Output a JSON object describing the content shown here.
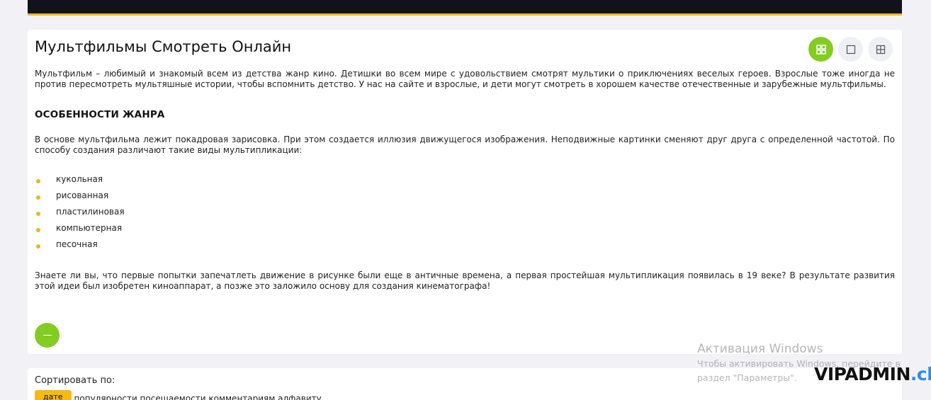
{
  "page": {
    "title": "Мультфильмы Смотреть Онлайн",
    "intro": "Мультфильм – любимый и знакомый всем из детства жанр кино. Детишки во всем мире с удовольствием смотрят мультики о приключениях веселых героев. Взрослые тоже иногда не против пересмотреть мультяшные истории, чтобы вспомнить детство. У нас на сайте и взрослые, и дети могут смотреть в хорошем качестве отечественные и зарубежные мультфильмы.",
    "section_heading": "ОСОБЕННОСТИ ЖАНРА",
    "section_text": "В основе мультфильма лежит покадровая зарисовка. При этом создается иллюзия движущегося изображения. Неподвижные картинки сменяют друг друга с определенной частотой. По способу создания различают такие виды мультипликации:",
    "types": [
      "кукольная",
      "рисованная",
      "пластилиновая",
      "компьютерная",
      "песочная"
    ],
    "closing_text": "Знаете ли вы, что первые попытки запечатлеть движение в рисунке были еще в античные времена, а первая простейшая мультипликация появилась в 19 веке? В результате развития этой идеи был изобретен киноаппарат, а позже это заложило основу для создания кинематографа!"
  },
  "view_toggles": [
    {
      "icon": "grid-small-icon",
      "active": true
    },
    {
      "icon": "single-square-icon",
      "active": false
    },
    {
      "icon": "grid-large-icon",
      "active": false
    }
  ],
  "collapse_button": {
    "icon": "minus-icon"
  },
  "sort": {
    "label": "Сортировать по:",
    "active_option": "дате",
    "options_text": "популярности посещаемости комментариям алфавиту"
  },
  "watermark": {
    "title": "Активация Windows",
    "line1": "Чтобы активировать Windows, перейдите в",
    "line2": "раздел \"Параметры\"."
  },
  "logo": {
    "main": "VIPADMIN",
    "suffix": ".club"
  },
  "colors": {
    "accent_green": "#84cc22",
    "accent_yellow": "#f5b915",
    "header_dark": "#12121c",
    "background": "#f2f2f6",
    "logo_blue": "#2b8ee6"
  }
}
